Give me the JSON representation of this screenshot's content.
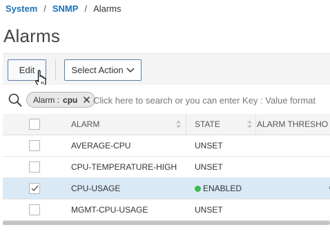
{
  "breadcrumb": {
    "items": [
      "System",
      "SNMP",
      "Alarms"
    ],
    "separator": "/"
  },
  "page": {
    "title": "Alarms"
  },
  "toolbar": {
    "edit_label": "Edit",
    "select_action_label": "Select Action"
  },
  "search": {
    "chip_key": "Alarm :",
    "chip_value": "cpu",
    "placeholder": "Click here to search or you can enter Key : Value format",
    "icon": "search-icon"
  },
  "table": {
    "columns": [
      "ALARM",
      "STATE",
      "ALARM THRESHO"
    ],
    "rows": [
      {
        "alarm": "AVERAGE-CPU",
        "state": "UNSET",
        "checked": false
      },
      {
        "alarm": "CPU-TEMPERATURE-HIGH",
        "state": "UNSET",
        "checked": false
      },
      {
        "alarm": "CPU-USAGE",
        "state": "ENABLED",
        "checked": true
      },
      {
        "alarm": "MGMT-CPU-USAGE",
        "state": "UNSET",
        "checked": false
      }
    ]
  },
  "colors": {
    "link": "#1f6fb5",
    "selected_row": "#d9e9f6",
    "enabled_dot": "#3fb950",
    "button_border": "#5b7fa6"
  }
}
